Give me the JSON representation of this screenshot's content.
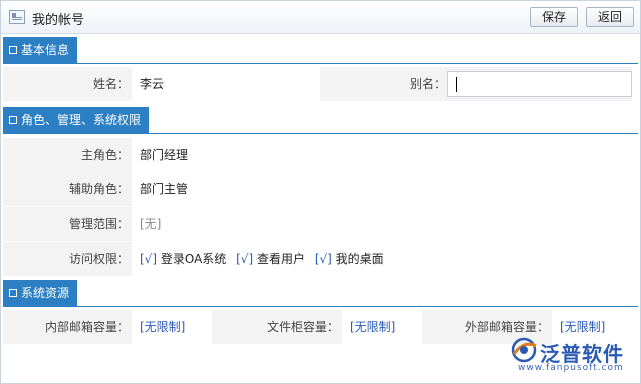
{
  "window": {
    "title": "我的帐号"
  },
  "toolbar": {
    "save_label": "保存",
    "back_label": "返回"
  },
  "sections": {
    "basic": {
      "title": "基本信息"
    },
    "roles": {
      "title": "角色、管理、系统权限"
    },
    "resources": {
      "title": "系统资源"
    }
  },
  "basic": {
    "name_label": "姓名：",
    "name_value": "李云",
    "alias_label": "别名：",
    "alias_value": ""
  },
  "roles": {
    "primary_label": "主角色：",
    "primary_value": "部门经理",
    "aux_label": "辅助角色：",
    "aux_value": "部门主管",
    "scope_label": "管理范围：",
    "scope_value": "[无]",
    "access_label": "访问权限：",
    "permissions": [
      {
        "check": "[√]",
        "label": "登录OA系统"
      },
      {
        "check": "[√]",
        "label": "查看用户"
      },
      {
        "check": "[√]",
        "label": "我的桌面"
      }
    ]
  },
  "resources": {
    "internal_mail_label": "内部邮箱容量：",
    "internal_mail_value": "[无限制]",
    "file_cabinet_label": "文件柜容量：",
    "file_cabinet_value": "[无限制]",
    "external_mail_label": "外部邮箱容量：",
    "external_mail_value": "[无限制]"
  },
  "brand": {
    "name": "泛普软件",
    "url": "www.fanpusoft.com",
    "color": "#2a5ab3"
  }
}
